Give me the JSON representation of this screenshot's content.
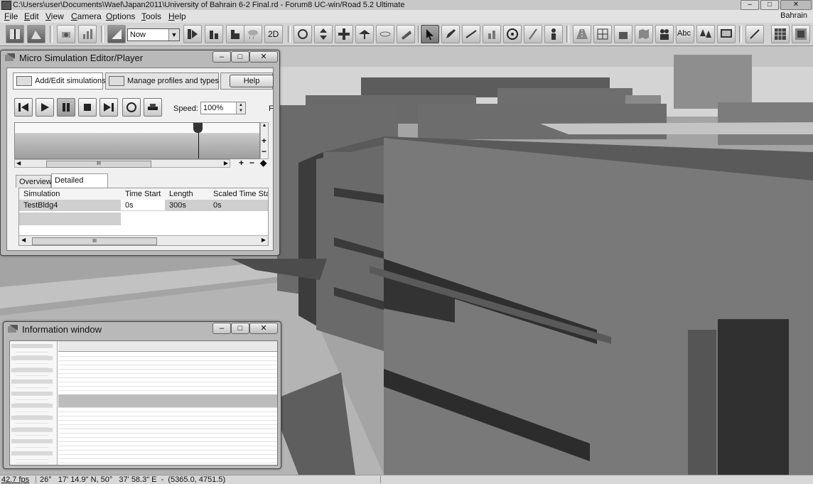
{
  "titlebar": {
    "title": "C:\\Users\\user\\Documents\\Wael\\Japan2011\\University of Bahrain 6-2 Final.rd - Forum8 UC-win/Road 5.2 Ultimate",
    "minimize": "–",
    "maximize": "□",
    "close": "✕"
  },
  "menubar": {
    "items": [
      "File",
      "Edit",
      "View",
      "Camera",
      "Options",
      "Tools",
      "Help"
    ],
    "region": "Bahrain"
  },
  "toolbar": {
    "time_select": "Now",
    "view_2d_label": "2D",
    "text_tool_label": "Abc"
  },
  "micro_sim": {
    "title": "Micro Simulation Editor/Player",
    "tab_add": "Add/Edit simulations",
    "tab_manage": "Manage profiles and types",
    "help": "Help",
    "speed_label": "Speed:",
    "speed_value": "100%",
    "cut_letter": "F",
    "subtab_overview": "Overview",
    "subtab_detailed": "Detailed editing",
    "grid_headers": [
      "Simulation",
      "Time Start",
      "Length",
      "Scaled Time Sta"
    ],
    "grid_row": [
      "TestBldg4",
      "0s",
      "300s",
      "0s"
    ],
    "scroll_thumb": "III"
  },
  "info_window": {
    "title": "Information window"
  },
  "statusbar": {
    "fps": "42.7 fps",
    "coord": "26°   17' 14.9\" N, 50°   37' 58.3\" E  -  (5365.0, 4751.5)"
  },
  "colors": {
    "sky": "#d6d6d6",
    "building_main": "#7a7a7a",
    "building_dark": "#3a3a3a",
    "ground": "#aaaaaa",
    "window_bg": "#b9b9b9"
  }
}
